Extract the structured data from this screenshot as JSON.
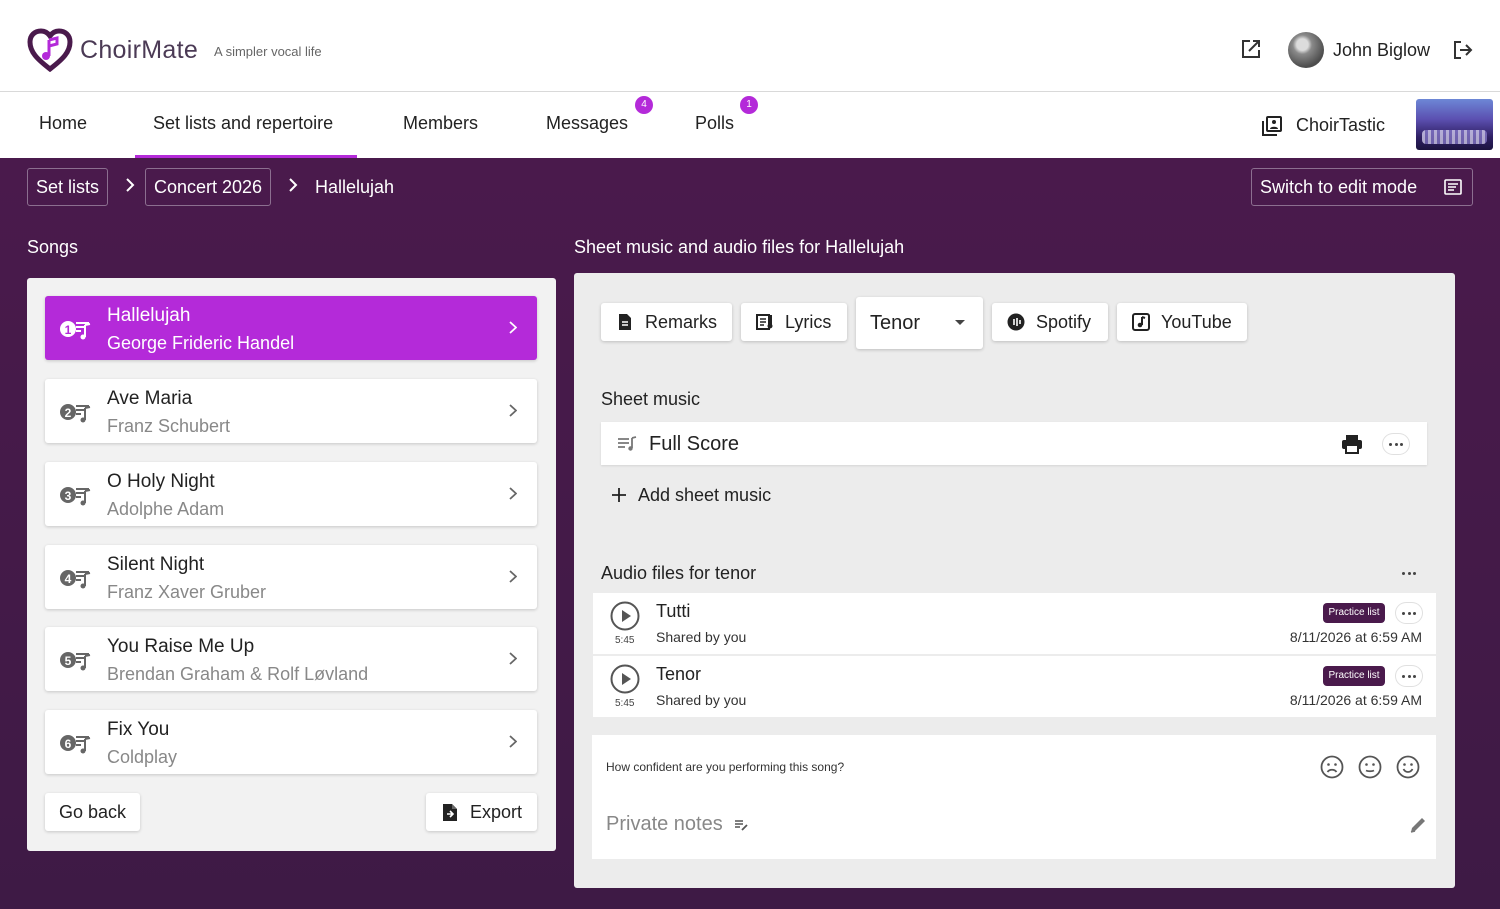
{
  "header": {
    "brand": "ChoirMate",
    "tagline": "A simpler vocal life",
    "user_name": "John Biglow"
  },
  "nav": {
    "items": [
      {
        "label": "Home"
      },
      {
        "label": "Set lists and repertoire"
      },
      {
        "label": "Members"
      },
      {
        "label": "Messages",
        "badge": "4"
      },
      {
        "label": "Polls",
        "badge": "1"
      }
    ],
    "choir_name": "ChoirTastic"
  },
  "breadcrumb": {
    "set_lists": "Set lists",
    "concert": "Concert 2026",
    "current": "Hallelujah"
  },
  "edit_mode_label": "Switch to edit mode",
  "songs": {
    "title": "Songs",
    "items": [
      {
        "num": "1",
        "title": "Hallelujah",
        "composer": "George Frideric Handel",
        "active": true
      },
      {
        "num": "2",
        "title": "Ave Maria",
        "composer": "Franz Schubert"
      },
      {
        "num": "3",
        "title": "O Holy Night",
        "composer": "Adolphe Adam"
      },
      {
        "num": "4",
        "title": "Silent Night",
        "composer": "Franz Xaver Gruber"
      },
      {
        "num": "5",
        "title": "You Raise Me Up",
        "composer": "Brendan Graham & Rolf Løvland"
      },
      {
        "num": "6",
        "title": "Fix You",
        "composer": "Coldplay"
      }
    ],
    "go_back": "Go back",
    "export": "Export"
  },
  "detail": {
    "title": "Sheet music and audio files for Hallelujah",
    "tools": {
      "remarks": "Remarks",
      "lyrics": "Lyrics",
      "voice": "Tenor",
      "spotify": "Spotify",
      "youtube": "YouTube"
    },
    "sheet_music_title": "Sheet music",
    "sheet_items": [
      {
        "name": "Full Score"
      }
    ],
    "add_sheet": "Add sheet music",
    "audio_title": "Audio files for tenor",
    "audio_files": [
      {
        "name": "Tutti",
        "duration": "5:45",
        "shared": "Shared by you",
        "badge": "Practice list",
        "date": "8/11/2026 at 6:59 AM"
      },
      {
        "name": "Tenor",
        "duration": "5:45",
        "shared": "Shared by you",
        "badge": "Practice list",
        "date": "8/11/2026 at 6:59 AM"
      }
    ],
    "confidence_question": "How confident are you performing this song?",
    "private_notes": "Private notes"
  },
  "colors": {
    "accent": "#b42ad9",
    "background": "#4a1a4c",
    "badge_dark": "#4a1a4c"
  },
  "icons": [
    "heart-logo-icon",
    "external-link-icon",
    "logout-icon",
    "library-icon",
    "chevron-right-icon",
    "edit-mode-icon",
    "song-number-icon",
    "document-icon",
    "lyrics-icon",
    "spotify-icon",
    "youtube-icon",
    "score-icon",
    "print-icon",
    "more-icon",
    "plus-icon",
    "play-icon",
    "sad-face-icon",
    "neutral-face-icon",
    "happy-face-icon",
    "notes-icon",
    "pencil-icon"
  ]
}
